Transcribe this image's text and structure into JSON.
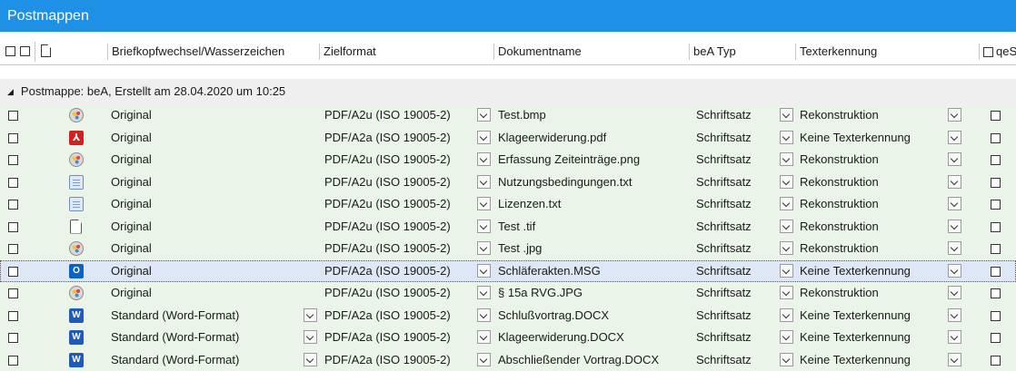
{
  "window": {
    "title": "Postmappen"
  },
  "columns": {
    "brief": "Briefkopfwechsel/Wasserzeichen",
    "ziel": "Zielformat",
    "doc": "Dokumentname",
    "bea": "beA Typ",
    "texterkennung": "Texterkennung",
    "qes": "qeS"
  },
  "group": {
    "label": "Postmappe: beA, Erstellt am 28.04.2020 um 10:25"
  },
  "rows": [
    {
      "icon": "image-file-icon",
      "brief": "Original",
      "ziel": "PDF/A2u (ISO 19005-2)",
      "doc": "Test.bmp",
      "bea": "Schriftsatz",
      "texterkennung": "Rekonstruktion"
    },
    {
      "icon": "pdf-file-icon",
      "brief": "Original",
      "ziel": "PDF/A2a (ISO 19005-2)",
      "doc": "Klageerwiderung.pdf",
      "bea": "Schriftsatz",
      "texterkennung": "Keine Texterkennung"
    },
    {
      "icon": "image-file-icon",
      "brief": "Original",
      "ziel": "PDF/A2u (ISO 19005-2)",
      "doc": "Erfassung Zeiteinträge.png",
      "bea": "Schriftsatz",
      "texterkennung": "Rekonstruktion"
    },
    {
      "icon": "text-file-icon",
      "brief": "Original",
      "ziel": "PDF/A2u (ISO 19005-2)",
      "doc": "Nutzungsbedingungen.txt",
      "bea": "Schriftsatz",
      "texterkennung": "Rekonstruktion"
    },
    {
      "icon": "text-file-icon",
      "brief": "Original",
      "ziel": "PDF/A2u (ISO 19005-2)",
      "doc": "Lizenzen.txt",
      "bea": "Schriftsatz",
      "texterkennung": "Rekonstruktion"
    },
    {
      "icon": "blank-file-icon",
      "brief": "Original",
      "ziel": "PDF/A2u (ISO 19005-2)",
      "doc": "Test .tif",
      "bea": "Schriftsatz",
      "texterkennung": "Rekonstruktion"
    },
    {
      "icon": "image-file-icon",
      "brief": "Original",
      "ziel": "PDF/A2u (ISO 19005-2)",
      "doc": "Test .jpg",
      "bea": "Schriftsatz",
      "texterkennung": "Rekonstruktion"
    },
    {
      "icon": "outlook-file-icon",
      "brief": "Original",
      "ziel": "PDF/A2a (ISO 19005-2)",
      "doc": "Schläferakten.MSG",
      "bea": "Schriftsatz",
      "texterkennung": "Keine Texterkennung",
      "selected": true
    },
    {
      "icon": "image-file-icon",
      "brief": "Original",
      "ziel": "PDF/A2u (ISO 19005-2)",
      "doc": "§ 15a RVG.JPG",
      "bea": "Schriftsatz",
      "texterkennung": "Rekonstruktion"
    },
    {
      "icon": "word-file-icon",
      "brief": "Standard (Word-Format)",
      "briefDropdown": true,
      "ziel": "PDF/A2a (ISO 19005-2)",
      "doc": "Schlußvortrag.DOCX",
      "bea": "Schriftsatz",
      "texterkennung": "Keine Texterkennung"
    },
    {
      "icon": "word-file-icon",
      "brief": "Standard (Word-Format)",
      "briefDropdown": true,
      "ziel": "PDF/A2a (ISO 19005-2)",
      "doc": "Klageerwiderung.DOCX",
      "bea": "Schriftsatz",
      "texterkennung": "Keine Texterkennung"
    },
    {
      "icon": "word-file-icon",
      "brief": "Standard (Word-Format)",
      "briefDropdown": true,
      "ziel": "PDF/A2a (ISO 19005-2)",
      "doc": "Abschließender Vortrag.DOCX",
      "bea": "Schriftsatz",
      "texterkennung": "Keine Texterkennung"
    }
  ]
}
